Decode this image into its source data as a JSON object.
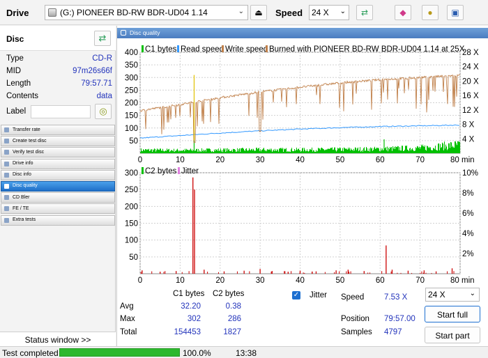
{
  "toolbar": {
    "drive_label": "Drive",
    "drive_value": "(G:)   PIONEER BD-RW   BDR-UD04 1.14",
    "speed_label": "Speed",
    "speed_value": "24 X"
  },
  "disc": {
    "title": "Disc",
    "rows": [
      {
        "key": "Type",
        "value": "CD-R"
      },
      {
        "key": "MID",
        "value": "97m26s66f"
      },
      {
        "key": "Length",
        "value": "79:57.71"
      },
      {
        "key": "Contents",
        "value": "data"
      }
    ],
    "label_key": "Label"
  },
  "nav": [
    {
      "label": "Transfer rate",
      "active": false
    },
    {
      "label": "Create test disc",
      "active": false
    },
    {
      "label": "Verify test disc",
      "active": false
    },
    {
      "label": "Drive info",
      "active": false
    },
    {
      "label": "Disc info",
      "active": false
    },
    {
      "label": "Disc quality",
      "active": true
    },
    {
      "label": "CD Bler",
      "active": false
    },
    {
      "label": "FE / TE",
      "active": false
    },
    {
      "label": "Extra tests",
      "active": false
    }
  ],
  "status_window_label": "Status window >>",
  "main_title": "Disc quality",
  "chart_data": [
    {
      "type": "line",
      "legend": [
        "C1 bytes",
        "Read speed",
        "Write speed",
        "Burned with PIONEER BD-RW   BDR-UD04 1.14 at 25X"
      ],
      "x_ticks": [
        "0",
        "10",
        "20",
        "30",
        "40",
        "50",
        "60",
        "70",
        "80 min"
      ],
      "y_ticks_left": [
        "400",
        "350",
        "300",
        "250",
        "200",
        "150",
        "100",
        "50"
      ],
      "y_ticks_right": [
        "28 X",
        "24 X",
        "20 X",
        "16 X",
        "12 X",
        "8 X",
        "4 X"
      ],
      "xlim": [
        0,
        80
      ],
      "ylim": [
        0,
        400
      ],
      "y2lim": [
        0,
        28
      ],
      "series": [
        {
          "name": "C1 bytes",
          "color": "#00c000",
          "x": [
            0,
            10,
            20,
            30,
            40,
            50,
            60,
            70,
            80
          ],
          "y": [
            12,
            11,
            12,
            13,
            13,
            14,
            16,
            20,
            32
          ]
        },
        {
          "name": "Read speed",
          "color": "#3399ff",
          "x": [
            0,
            10,
            20,
            30,
            40,
            50,
            60,
            70,
            80
          ],
          "y": [
            4.2,
            4.9,
            5.6,
            6.2,
            6.7,
            7.1,
            7.4,
            7.6,
            7.8
          ]
        },
        {
          "name": "Write speed",
          "color": "#c0804a",
          "x": [
            0,
            10,
            20,
            30,
            40,
            50,
            60,
            70,
            80
          ],
          "y": [
            11.8,
            13.5,
            15.4,
            17.0,
            18.3,
            19.5,
            20.4,
            21.0,
            21.6
          ]
        }
      ],
      "spikes_c1": [
        {
          "x": 13.5,
          "y": 90
        },
        {
          "x": 61,
          "y": 55
        }
      ]
    },
    {
      "type": "bar",
      "legend": [
        "C2 bytes",
        "Jitter"
      ],
      "x_ticks": [
        "0",
        "10",
        "20",
        "30",
        "40",
        "50",
        "60",
        "70",
        "80 min"
      ],
      "y_ticks_left": [
        "300",
        "250",
        "200",
        "150",
        "100",
        "50"
      ],
      "y_ticks_right": [
        "10%",
        "8%",
        "6%",
        "4%",
        "2%"
      ],
      "xlim": [
        0,
        80
      ],
      "ylim": [
        0,
        300
      ],
      "series": [
        {
          "name": "C2 bytes",
          "color": "#cc0000",
          "x": [
            13.2,
            13.6,
            61.5,
            0.5,
            5,
            9,
            16,
            21,
            26,
            30,
            33,
            37,
            40,
            44,
            49,
            52,
            56,
            63,
            67,
            71,
            74,
            78
          ],
          "y": [
            286,
            250,
            84,
            10,
            6,
            8,
            12,
            7,
            9,
            14,
            8,
            6,
            9,
            7,
            10,
            12,
            8,
            12,
            9,
            10,
            7,
            16
          ]
        }
      ]
    }
  ],
  "stats": {
    "col_c1": "C1 bytes",
    "col_c2": "C2 bytes",
    "rows": [
      {
        "label": "Avg",
        "c1": "32.20",
        "c2": "0.38"
      },
      {
        "label": "Max",
        "c1": "302",
        "c2": "286"
      },
      {
        "label": "Total",
        "c1": "154453",
        "c2": "1827"
      }
    ],
    "jitter_label": "Jitter",
    "speed_label": "Speed",
    "speed_value": "7.53 X",
    "position_label": "Position",
    "position_value": "79:57.00",
    "samples_label": "Samples",
    "samples_value": "4797",
    "speed_select": "24 X",
    "start_full": "Start full",
    "start_part": "Start part"
  },
  "statusbar": {
    "text": "Test completed",
    "progress": 100,
    "progress_text": "100.0%",
    "time": "13:38"
  },
  "colors": {
    "accent": "#1c6fd0",
    "value_blue": "#2233bb",
    "progress_green": "#2eb82e"
  }
}
